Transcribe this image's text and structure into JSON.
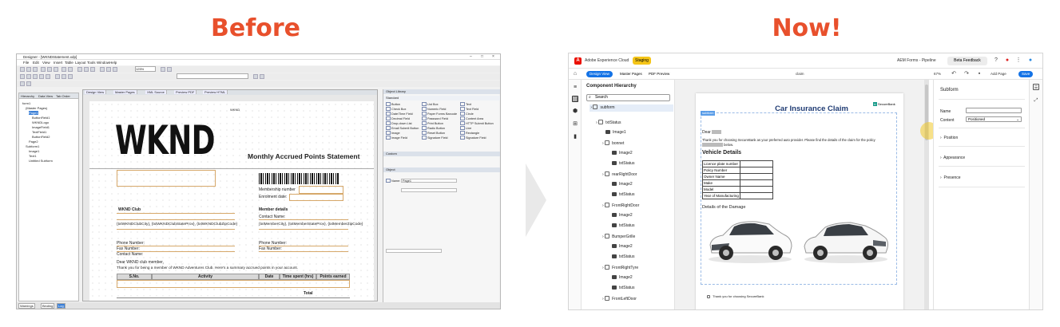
{
  "headings": {
    "before": "Before",
    "now": "Now!"
  },
  "old": {
    "title": "Designer - [WKNDStatement.xdp]",
    "menu": [
      "File",
      "Edit",
      "View",
      "Insert",
      "Table",
      "Layout",
      "Tools",
      "Window",
      "Help"
    ],
    "zoom": "125%",
    "left_tabs": [
      "Hierarchy",
      "Data View",
      "Tab Order"
    ],
    "tree": [
      "form1",
      "(Master Pages)",
      "Page1",
      "ButtonField1",
      "WKNDLogo",
      "ImageField1",
      "TextField1",
      "ButtonField2",
      "Page2",
      "Subform1",
      "Image1",
      "Text1",
      "Untitled Subform"
    ],
    "doc_tabs": [
      "Design View",
      "Master Pages",
      "XML Source",
      "Preview PDF",
      "Preview HTML"
    ],
    "wknd": "WKND",
    "wknd_small": "WKND",
    "statement": "Monthly Accrued Points Statement",
    "membership_number": "Membership number",
    "enrolment_date": "Enrolment date:",
    "club": "WKND Club",
    "member_details": "Member details",
    "contact_name": "Contact Name:",
    "club_addr": "{txtWKNDClubCity}, {txtWKNDClubStateProv}, {txtWKNDClubZipCode}",
    "member_addr": "{txtMemberCity}, {txtMemberStateProv}, {txtMemberZipCode}",
    "phone": "Phone Number:",
    "fax": "Fax Number:",
    "contact_name2": "Contact Name:",
    "dear": "Dear WKND club member,",
    "thanks": "Thank you for being a member of WKND Adventures Club. Here's a summary accrued points in your account.",
    "cols": [
      "S.No.",
      "Activity",
      "Date",
      "Time spent (hrs)",
      "Points earned"
    ],
    "total": "Total",
    "right_head1": "Object Library",
    "right_head2": "Standard",
    "objects": [
      "Button",
      "Check Box",
      "Date/Time Field",
      "Decimal Field",
      "Drop-down List",
      "Email Submit Button",
      "Image",
      "Image Field",
      "List Box",
      "Numeric Field",
      "Paper Forms Barcode",
      "Password Field",
      "Print Button",
      "Radio Button",
      "Reset Button",
      "Signature Field",
      "Text",
      "Text Field",
      "Circle",
      "Content Area",
      "HTTP Submit Button",
      "Line",
      "Rectangle",
      "Signature Field"
    ],
    "right_head3": "Custom",
    "right_head4": "Object",
    "name_label": "Name:",
    "name_value": "Page1",
    "status_tabs": [
      "Warnings",
      "Binding",
      "Log"
    ]
  },
  "nw": {
    "app": "Adobe Experience Cloud",
    "badge": "Staging",
    "product": "AEM Forms - Pipeline",
    "feedback": "Beta Feedback",
    "tabs": [
      "Design View",
      "Master Pages",
      "PDF Preview"
    ],
    "doc_name": "claim",
    "zoom": "67%",
    "add_page": "Add Page",
    "save": "Save",
    "hier_title": "Component Hierarchy",
    "search": "Search",
    "tree": [
      {
        "label": "subform",
        "kind": "check"
      },
      {
        "label": "txtStatus",
        "kind": "check"
      },
      {
        "label": "Image1",
        "kind": "img"
      },
      {
        "label": "bonnet",
        "kind": "check"
      },
      {
        "label": "Image2",
        "kind": "img"
      },
      {
        "label": "txtStatus",
        "kind": "img"
      },
      {
        "label": "rearRightDoor",
        "kind": "check"
      },
      {
        "label": "Image2",
        "kind": "img"
      },
      {
        "label": "txtStatus",
        "kind": "img"
      },
      {
        "label": "FrontRightDoor",
        "kind": "check"
      },
      {
        "label": "Image2",
        "kind": "img"
      },
      {
        "label": "txtStatus",
        "kind": "img"
      },
      {
        "label": "BumperGrille",
        "kind": "check"
      },
      {
        "label": "Image2",
        "kind": "img"
      },
      {
        "label": "txtStatus",
        "kind": "img"
      },
      {
        "label": "FrontRightTyre",
        "kind": "check"
      },
      {
        "label": "Image2",
        "kind": "img"
      },
      {
        "label": "txtStatus",
        "kind": "img"
      },
      {
        "label": "FrontLeftDoor",
        "kind": "check"
      }
    ],
    "subform_tag": "subform",
    "brand": "SecureBank",
    "claim_title": "Car Insurance Claim",
    "dear": "Dear",
    "thanks": "Thank you for choosing SecureBank as your preferred auto provider. Please find the details of the claim for the policy",
    "policy_suffix": "below.",
    "vehicle": "Vehicle Details",
    "rows": [
      "Licence plate number",
      "Policy Number",
      "Owner Name",
      "Make",
      "Model",
      "Year of Manufacturing"
    ],
    "damage": "Details of the Damage",
    "footer_check": "Thank you for choosing SecureBank",
    "props_title": "Subform",
    "name_label": "Name",
    "content_label": "Content",
    "content_value": "Positioned",
    "sections": [
      "Position",
      "Appearance",
      "Presence"
    ]
  }
}
